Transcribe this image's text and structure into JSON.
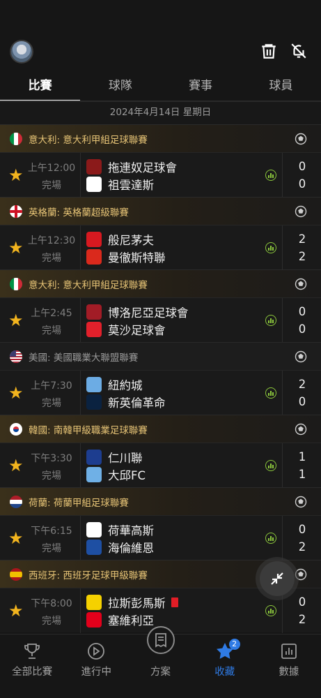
{
  "tabs": [
    "比賽",
    "球隊",
    "賽事",
    "球員"
  ],
  "date": "2024年4月14日 星期日",
  "groups": [
    {
      "league": "意大利: 意大利甲組足球聯賽",
      "flag": "italy",
      "time": "上午12:00",
      "status": "完場",
      "home": "拖連奴足球會",
      "away": "祖雲達斯",
      "home_score": "0",
      "away_score": "0",
      "home_crest": "#8b1a1a",
      "away_crest": "#ffffff"
    },
    {
      "league": "英格蘭: 英格蘭超級聯賽",
      "flag": "england",
      "time": "上午12:30",
      "status": "完場",
      "home": "般尼茅夫",
      "away": "曼徹斯特聯",
      "home_score": "2",
      "away_score": "2",
      "home_crest": "#d71920",
      "away_crest": "#da291c"
    },
    {
      "league": "意大利: 意大利甲組足球聯賽",
      "flag": "italy",
      "time": "上午2:45",
      "status": "完場",
      "home": "博洛尼亞足球會",
      "away": "莫沙足球會",
      "home_score": "0",
      "away_score": "0",
      "home_crest": "#a21c26",
      "away_crest": "#e2202b"
    },
    {
      "league": "美國: 美國職業大聯盟聯賽",
      "flag": "usa",
      "time": "上午7:30",
      "status": "完場",
      "home": "紐約城",
      "away": "新英倫革命",
      "home_score": "2",
      "away_score": "0",
      "home_crest": "#6cace4",
      "away_crest": "#0a2240",
      "plain": true
    },
    {
      "league": "韓國: 南韓甲級職業足球聯賽",
      "flag": "korea",
      "time": "下午3:30",
      "status": "完場",
      "home": "仁川聯",
      "away": "大邱FC",
      "home_score": "1",
      "away_score": "1",
      "home_crest": "#1d3d8f",
      "away_crest": "#6fb0e6"
    },
    {
      "league": "荷蘭: 荷蘭甲組足球聯賽",
      "flag": "netherlands",
      "time": "下午6:15",
      "status": "完場",
      "home": "荷華高斯",
      "away": "海倫維恩",
      "home_score": "0",
      "away_score": "2",
      "home_crest": "#ffffff",
      "away_crest": "#1e4fa3"
    },
    {
      "league": "西班牙: 西班牙足球甲級聯賽",
      "flag": "spain",
      "time": "下午8:00",
      "status": "完場",
      "home": "拉斯彭馬斯",
      "away": "塞維利亞",
      "home_score": "0",
      "away_score": "2",
      "home_crest": "#f5d100",
      "away_crest": "#e3001b",
      "home_red_card": true
    }
  ],
  "nav": {
    "items": [
      {
        "label": "全部比賽",
        "icon": "trophy-icon"
      },
      {
        "label": "進行中",
        "icon": "play-icon"
      },
      {
        "label": "方案",
        "icon": "document-icon"
      },
      {
        "label": "收藏",
        "icon": "star-icon"
      },
      {
        "label": "數據",
        "icon": "chart-icon"
      }
    ],
    "favorites_badge": "2"
  },
  "colors": {
    "accent": "#2f7be5",
    "star": "#f2b41e",
    "league_gold": "#e7c476",
    "odds_green": "#8cc83c"
  }
}
